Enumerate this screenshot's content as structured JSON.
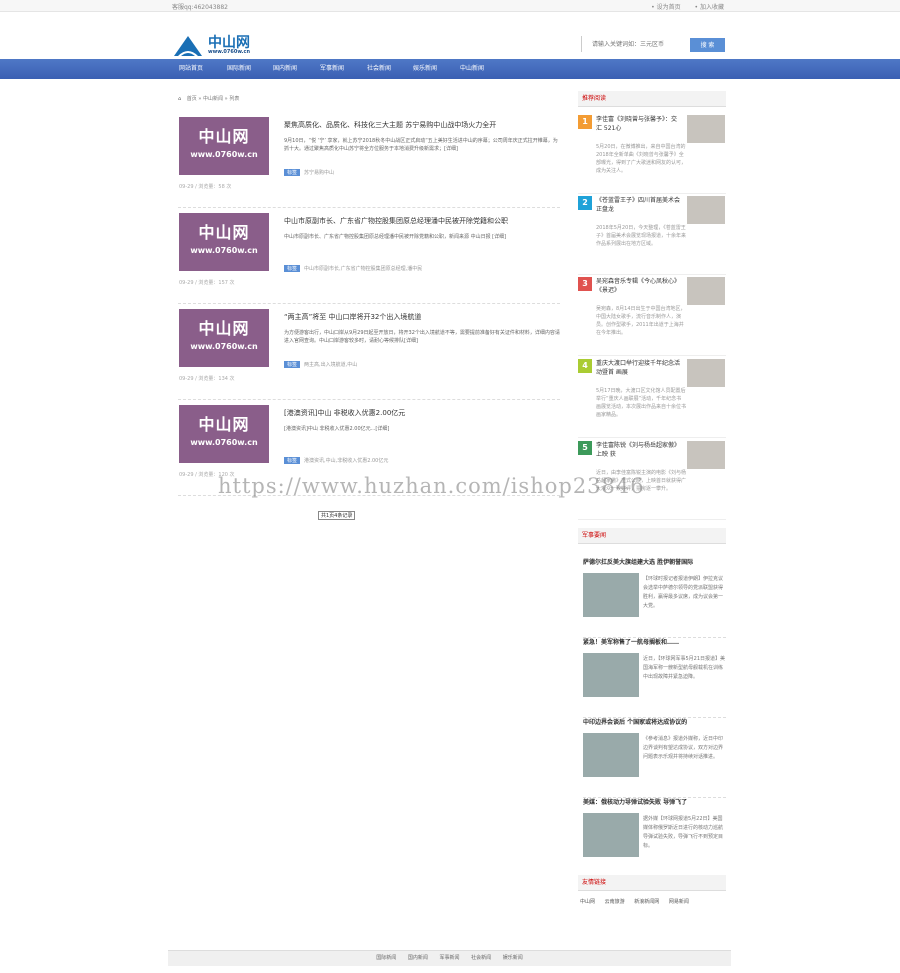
{
  "topbar": {
    "qq": "客服qq:462043882",
    "links": [
      "• 设为首页",
      "• 加入收藏"
    ]
  },
  "logo": {
    "name": "中山网",
    "url": "www.0760w.cn"
  },
  "search": {
    "placeholder": "请输入关键词如：三元区币",
    "button": "搜 索"
  },
  "nav": [
    "网站首页",
    "国际新闻",
    "国内新闻",
    "军事新闻",
    "社会新闻",
    "娱乐新闻",
    "中山新闻"
  ],
  "breadcrumb": {
    "home": "首页",
    "cat": "中山新闻",
    "cur": "列表"
  },
  "thumb": {
    "big": "中山网",
    "small": "www.0760w.cn"
  },
  "articles": [
    {
      "title": "聚焦高质化、品质化、科技化三大主题 苏宁易购中山战中场火力全开",
      "desc": "9月10日，“悦 ‘宁’ 享家，就上苏宁2018秋冬中山战区正式启动“五上美好生活进中山的序幕；公司周年庆正式拉开帷幕，为抓十大。通过聚焦高质化中山苏宁将全方位服务于本地消费升级新需求；[详细]",
      "tag": "标签",
      "tags": "苏宁易购中山",
      "meta": "09-29 / 浏览量：58 次"
    },
    {
      "title": "中山市原副市长、广东省广物控股集团原总经理潘中民被开除党籍和公职",
      "desc": "中山市原副市长、广东省广物控股集团原总经理潘中民被开除党籍和公职，新闻来源 中山日报 [详细]",
      "tag": "标签",
      "tags": "中山市原副市长,广东省广物控股集团原总经理,潘中民",
      "meta": "09-29 / 浏览量：157 次"
    },
    {
      "title": "“两主高”将至 中山口岸将开32个出入境航道",
      "desc": "为方便游客出行，中山口岸从9月29日起至开放日，将开32个出入境航道不等，需要提前准备好有关证件和材料，详细内容请进入官网查询。中山口岸游客较多时，请耐心等候排队[详细]",
      "tag": "标签",
      "tags": "两主高,出入境航道,中山",
      "meta": "09-29 / 浏览量：134 次"
    },
    {
      "title": "[港澳资讯]中山 非税收入优惠2.00亿元",
      "desc": "[港澳资讯]中山 非税收入优惠2.00亿元...[详细]",
      "tag": "标签",
      "tags": "港澳资讯,中山,非税收入优惠2.00亿元",
      "meta": "09-29 / 浏览量：120 次"
    }
  ],
  "pager": "共1页4条记录",
  "sidebar": {
    "rank_title": "推荐阅读",
    "rank": [
      {
        "num": "1",
        "color": "#f39c34",
        "title": "李佳富《刘晓曾与张馨予》：交汇 521心",
        "desc": "5月20日，在微博推出，来自中国台湾的2018年全新单曲《刘晓曾与张馨予》全部曝光，得到了广大歌迷和网友的认可，成为关注人。"
      },
      {
        "num": "2",
        "color": "#1fa2d8",
        "title": "《苍蓝雷王子》四川首届美术会 正盘龙",
        "desc": "2018年5月20日，今天整理，《苍蓝雷王子》首届美术会展览现场报道，十余年来作品系列展出在地方区域。"
      },
      {
        "num": "3",
        "color": "#e0524f",
        "title": "吴宛森音乐专辑《今心凤秋心》《景迟》",
        "desc": "吴宛森，8月14日出生于中国台湾地区，中国大陆女歌手，流行音乐制作人，演员。创作型歌手，2011年出道于上海并在今年推出。"
      },
      {
        "num": "4",
        "color": "#aacc33",
        "title": "重庆大渡口举行迎接千年纪念活动暨首 画展",
        "desc": "5月17日晚，大渡口区文化馆人员配置后举行“重庆人画联展”活动，千年纪念书画展览活动，本次展出作品来自十余位书画家精品。"
      },
      {
        "num": "5",
        "color": "#3c9a5a",
        "title": "李佳富陈锐《刘与杨岳超家傲》上映 获",
        "desc": "近日，由李佳富陈锐主演的电影《刘与杨岳超家傲》正式公映，上映首日就获得广大观众一致好评，票房逐一攀升。"
      }
    ],
    "mil_title": "军事要闻",
    "mil": [
      {
        "title": "萨德尔扛反美大旗组建大选 胜伊朝誉国际",
        "desc": "【环球时报记者报道伊朗】伊拉克议会选举中萨德尔领导的党派联盟获得胜利，赢得最多议席，成为议会第一大党。"
      },
      {
        "title": "紧急！美军称售了一航母搁板和……",
        "desc": "近日，【环球网军事5月21日报道】美国海军称一艘新型航母舰载机在训练中出现故障并紧急迫降。"
      },
      {
        "title": "中印边界会谈后 个国家或将达成协议的",
        "desc": "《参考消息》报道外媒称，近日中印边界谈判有望达成协议，双方对边界问题表示乐观并将持续对话推进。"
      },
      {
        "title": "美媒：俄核动力导弹试验失败 导弹飞了",
        "desc": "据外媒【环球网报道5月22日】美国媒体称俄罗斯近日进行的核动力巡航导弹试验失败，导弹飞行不到预定目标。"
      }
    ],
    "flinks_title": "友情链接",
    "flinks": [
      "中山网",
      "云南旅游",
      "新浪新闻网",
      "网易新闻"
    ]
  },
  "footer": [
    "国际新闻",
    "国内新闻",
    "军事新闻",
    "社会新闻",
    "娱乐新闻"
  ],
  "watermark": "https://www.huzhan.com/ishop23846"
}
